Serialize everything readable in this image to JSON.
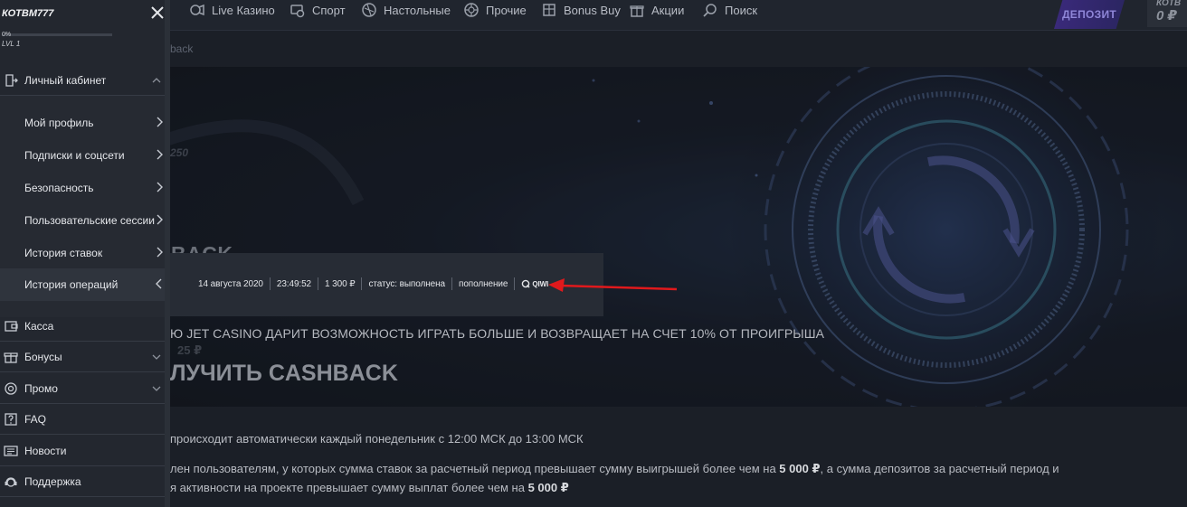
{
  "topnav": {
    "items": [
      {
        "label": "Live Казино",
        "icon": "live-casino-icon"
      },
      {
        "label": "Спорт",
        "icon": "sport-icon"
      },
      {
        "label": "Настольные",
        "icon": "table-games-icon"
      },
      {
        "label": "Прочие",
        "icon": "other-games-icon"
      },
      {
        "label": "Bonus Buy",
        "icon": "bonus-buy-icon"
      },
      {
        "label": "Акции",
        "icon": "promotions-icon"
      },
      {
        "label": "Поиск",
        "icon": "search-icon"
      }
    ],
    "deposit_label": "ДЕПОЗИТ",
    "wallet_name": "КОТВ",
    "wallet_balance": "0 ₽"
  },
  "breadcrumb": "back",
  "sidebar": {
    "username": "КОТВМ777",
    "progress_label": "0%",
    "progress_fraction": 0.0,
    "level_label": "LVL 1",
    "account": {
      "label": "Личный кабинет",
      "icon": "account-icon"
    },
    "account_items": [
      {
        "label": "Мой профиль"
      },
      {
        "label": "Подписки и соцсети"
      },
      {
        "label": "Безопасность"
      },
      {
        "label": "Пользовательские сессии"
      },
      {
        "label": "История ставок"
      },
      {
        "label": "История операций"
      }
    ],
    "main_items": [
      {
        "label": "Касса",
        "icon": "cashier-icon",
        "chevron": false
      },
      {
        "label": "Бонусы",
        "icon": "bonus-icon",
        "chevron": true
      },
      {
        "label": "Промо",
        "icon": "promo-icon",
        "chevron": true
      },
      {
        "label": "FAQ",
        "icon": "faq-icon",
        "chevron": false
      },
      {
        "label": "Новости",
        "icon": "news-icon",
        "chevron": false
      },
      {
        "label": "Поддержка",
        "icon": "support-icon",
        "chevron": false
      }
    ]
  },
  "operation": {
    "date": "14 августа 2020",
    "time": "23:49:52",
    "amount": "1 300 ₽",
    "status": "статус: выполнена",
    "type": "пополнение",
    "method": "QIWI"
  },
  "content": {
    "hero_title_partial": "BACK",
    "hero_ghost_number": "250",
    "promo_text": "Ю JET CASINO ДАРИТ ВОЗМОЖНОСТЬ ИГРАТЬ БОЛЬШЕ И ВОЗВРАЩАЕТ НА СЧЕТ 10% ОТ ПРОИГРЫША",
    "ghost_amount": "25 ₽",
    "cashback_title": "ЛУЧИТЬ CASHBACK",
    "rule1": "происходит автоматически каждый понедельник с 12:00 МСК до 13:00 МСК",
    "rule2_a": "лен пользователям, у которых сумма ставок за расчетный период превышает сумму выигрышей более чем на ",
    "rule2_b": "5 000 ₽",
    "rule2_c": ", а сумма депозитов за расчетный период и",
    "rule3_a": "я активности на проекте превышает сумму выплат более чем на ",
    "rule3_b": "5 000 ₽"
  },
  "colors": {
    "accent_purple": "#3b2a7c",
    "arrow_red": "#e0191c",
    "sidebar_bg": "#23272f"
  }
}
